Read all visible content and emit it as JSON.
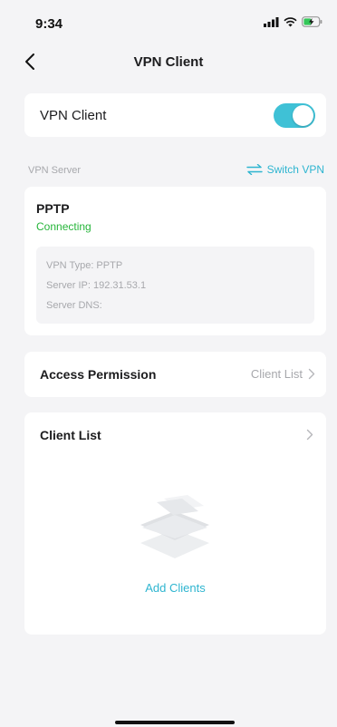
{
  "status_bar": {
    "time": "9:34"
  },
  "nav": {
    "title": "VPN Client"
  },
  "vpn_toggle": {
    "label": "VPN Client",
    "enabled": true
  },
  "server_section": {
    "label": "VPN Server",
    "switch_label": "Switch VPN"
  },
  "server": {
    "type": "PPTP",
    "status": "Connecting",
    "info": [
      "VPN Type: PPTP",
      "Server IP: 192.31.53.1",
      "Server DNS:"
    ]
  },
  "access_permission": {
    "label": "Access Permission",
    "value": "Client List"
  },
  "client_list": {
    "label": "Client List",
    "add_label": "Add Clients"
  },
  "colors": {
    "accent": "#3fc1d6",
    "link": "#2eb5d0",
    "status_ok": "#26b53a"
  }
}
